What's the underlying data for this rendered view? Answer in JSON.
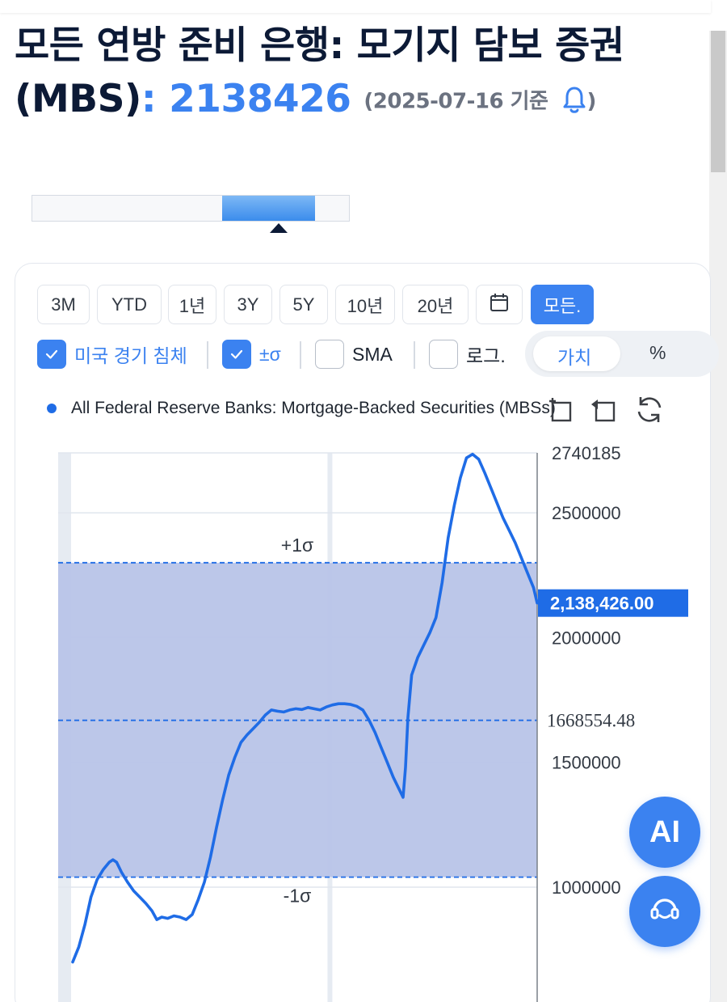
{
  "header": {
    "title": "모든 연방 준비 은행: 모기지 담보 증권",
    "title_code": "(MBS)",
    "colon": ":",
    "value": "2138426",
    "as_of": "(2025-07-16 기준",
    "close_paren": ")"
  },
  "range_buttons": [
    {
      "label": "3M",
      "active": false
    },
    {
      "label": "YTD",
      "active": false
    },
    {
      "label": "1년",
      "active": false
    },
    {
      "label": "3Y",
      "active": false
    },
    {
      "label": "5Y",
      "active": false
    },
    {
      "label": "10년",
      "active": false
    },
    {
      "label": "20년",
      "active": false
    },
    {
      "label": "",
      "icon": "calendar-icon",
      "active": false
    },
    {
      "label": "모든.",
      "active": true
    }
  ],
  "options": {
    "recession": {
      "label": "미국 경기 침체",
      "checked": true
    },
    "sigma": {
      "label": "±σ",
      "checked": true
    },
    "sma": {
      "label": "SMA",
      "checked": false
    },
    "log": {
      "label": "로그.",
      "checked": false
    }
  },
  "segmented": {
    "value_label": "가치",
    "percent_label": "%",
    "selected": "가치"
  },
  "toolbar_icons": [
    "zoom-in-icon",
    "zoom-out-icon",
    "refresh-icon"
  ],
  "fab": {
    "ai_label": "AI",
    "help_icon": "headset-icon"
  },
  "colors": {
    "accent": "#3b82f0",
    "line": "#1f6ce6",
    "band": "#b8c4e8",
    "label_bg": "#1f6ce6"
  },
  "chart_data": {
    "type": "line",
    "series": [
      {
        "name": "All Federal Reserve Banks: Mortgage-Backed Securities (MBSs)",
        "points": [
          [
            0,
            700000
          ],
          [
            0.5,
            760000
          ],
          [
            1,
            850000
          ],
          [
            1.5,
            960000
          ],
          [
            2,
            1030000
          ],
          [
            2.5,
            1070000
          ],
          [
            3,
            1100000
          ],
          [
            3.3,
            1110000
          ],
          [
            3.6,
            1100000
          ],
          [
            4,
            1060000
          ],
          [
            4.5,
            1020000
          ],
          [
            5,
            985000
          ],
          [
            5.5,
            960000
          ],
          [
            6,
            935000
          ],
          [
            6.5,
            905000
          ],
          [
            6.9,
            870000
          ],
          [
            7.3,
            880000
          ],
          [
            7.8,
            875000
          ],
          [
            8.3,
            885000
          ],
          [
            8.8,
            880000
          ],
          [
            9.3,
            870000
          ],
          [
            9.8,
            890000
          ],
          [
            10.3,
            950000
          ],
          [
            10.8,
            1020000
          ],
          [
            11.3,
            1120000
          ],
          [
            11.8,
            1240000
          ],
          [
            12.3,
            1350000
          ],
          [
            12.8,
            1450000
          ],
          [
            13.3,
            1520000
          ],
          [
            13.8,
            1580000
          ],
          [
            14.3,
            1610000
          ],
          [
            14.8,
            1635000
          ],
          [
            15.3,
            1660000
          ],
          [
            15.8,
            1690000
          ],
          [
            16.3,
            1710000
          ],
          [
            16.8,
            1705000
          ],
          [
            17.3,
            1702000
          ],
          [
            17.8,
            1710000
          ],
          [
            18.3,
            1715000
          ],
          [
            18.8,
            1712000
          ],
          [
            19.3,
            1720000
          ],
          [
            19.8,
            1715000
          ],
          [
            20.3,
            1710000
          ],
          [
            20.8,
            1722000
          ],
          [
            21.3,
            1730000
          ],
          [
            21.8,
            1735000
          ],
          [
            22.3,
            1735000
          ],
          [
            22.8,
            1732000
          ],
          [
            23.3,
            1725000
          ],
          [
            23.8,
            1710000
          ],
          [
            24.3,
            1670000
          ],
          [
            24.8,
            1620000
          ],
          [
            25.3,
            1560000
          ],
          [
            25.8,
            1500000
          ],
          [
            26.3,
            1440000
          ],
          [
            26.8,
            1390000
          ],
          [
            27.1,
            1360000
          ],
          [
            27.3,
            1480000
          ],
          [
            27.5,
            1680000
          ],
          [
            27.8,
            1850000
          ],
          [
            28.3,
            1920000
          ],
          [
            28.8,
            1970000
          ],
          [
            29.3,
            2020000
          ],
          [
            29.8,
            2080000
          ],
          [
            30.3,
            2220000
          ],
          [
            30.8,
            2400000
          ],
          [
            31.3,
            2530000
          ],
          [
            31.8,
            2640000
          ],
          [
            32.3,
            2720000
          ],
          [
            32.8,
            2735000
          ],
          [
            33.3,
            2715000
          ],
          [
            33.8,
            2660000
          ],
          [
            34.3,
            2600000
          ],
          [
            34.8,
            2540000
          ],
          [
            35.3,
            2480000
          ],
          [
            35.8,
            2430000
          ],
          [
            36.3,
            2380000
          ],
          [
            36.8,
            2320000
          ],
          [
            37.3,
            2260000
          ],
          [
            37.8,
            2200000
          ],
          [
            38.1,
            2138426
          ]
        ]
      }
    ],
    "xlim": [
      0,
      38.1
    ],
    "y_ticks": [
      "2740185",
      "2500000",
      "2000000",
      "1500000",
      "1000000"
    ],
    "y_tick_values": [
      2740185,
      2500000,
      2000000,
      1500000,
      1000000
    ],
    "ylim": [
      700000,
      2760000
    ],
    "mean": 1668554.48,
    "mean_label": "1668554.48",
    "plus_sigma": 2300000,
    "plus_sigma_label": "+1σ",
    "minus_sigma": 1040000,
    "minus_sigma_label": "-1σ",
    "last_value": 2138426,
    "last_value_label": "2,138,426.00",
    "recession_shading": [
      [
        0,
        0.8
      ],
      [
        20.9,
        21.2
      ]
    ],
    "legend": "top-left",
    "grid": true
  }
}
